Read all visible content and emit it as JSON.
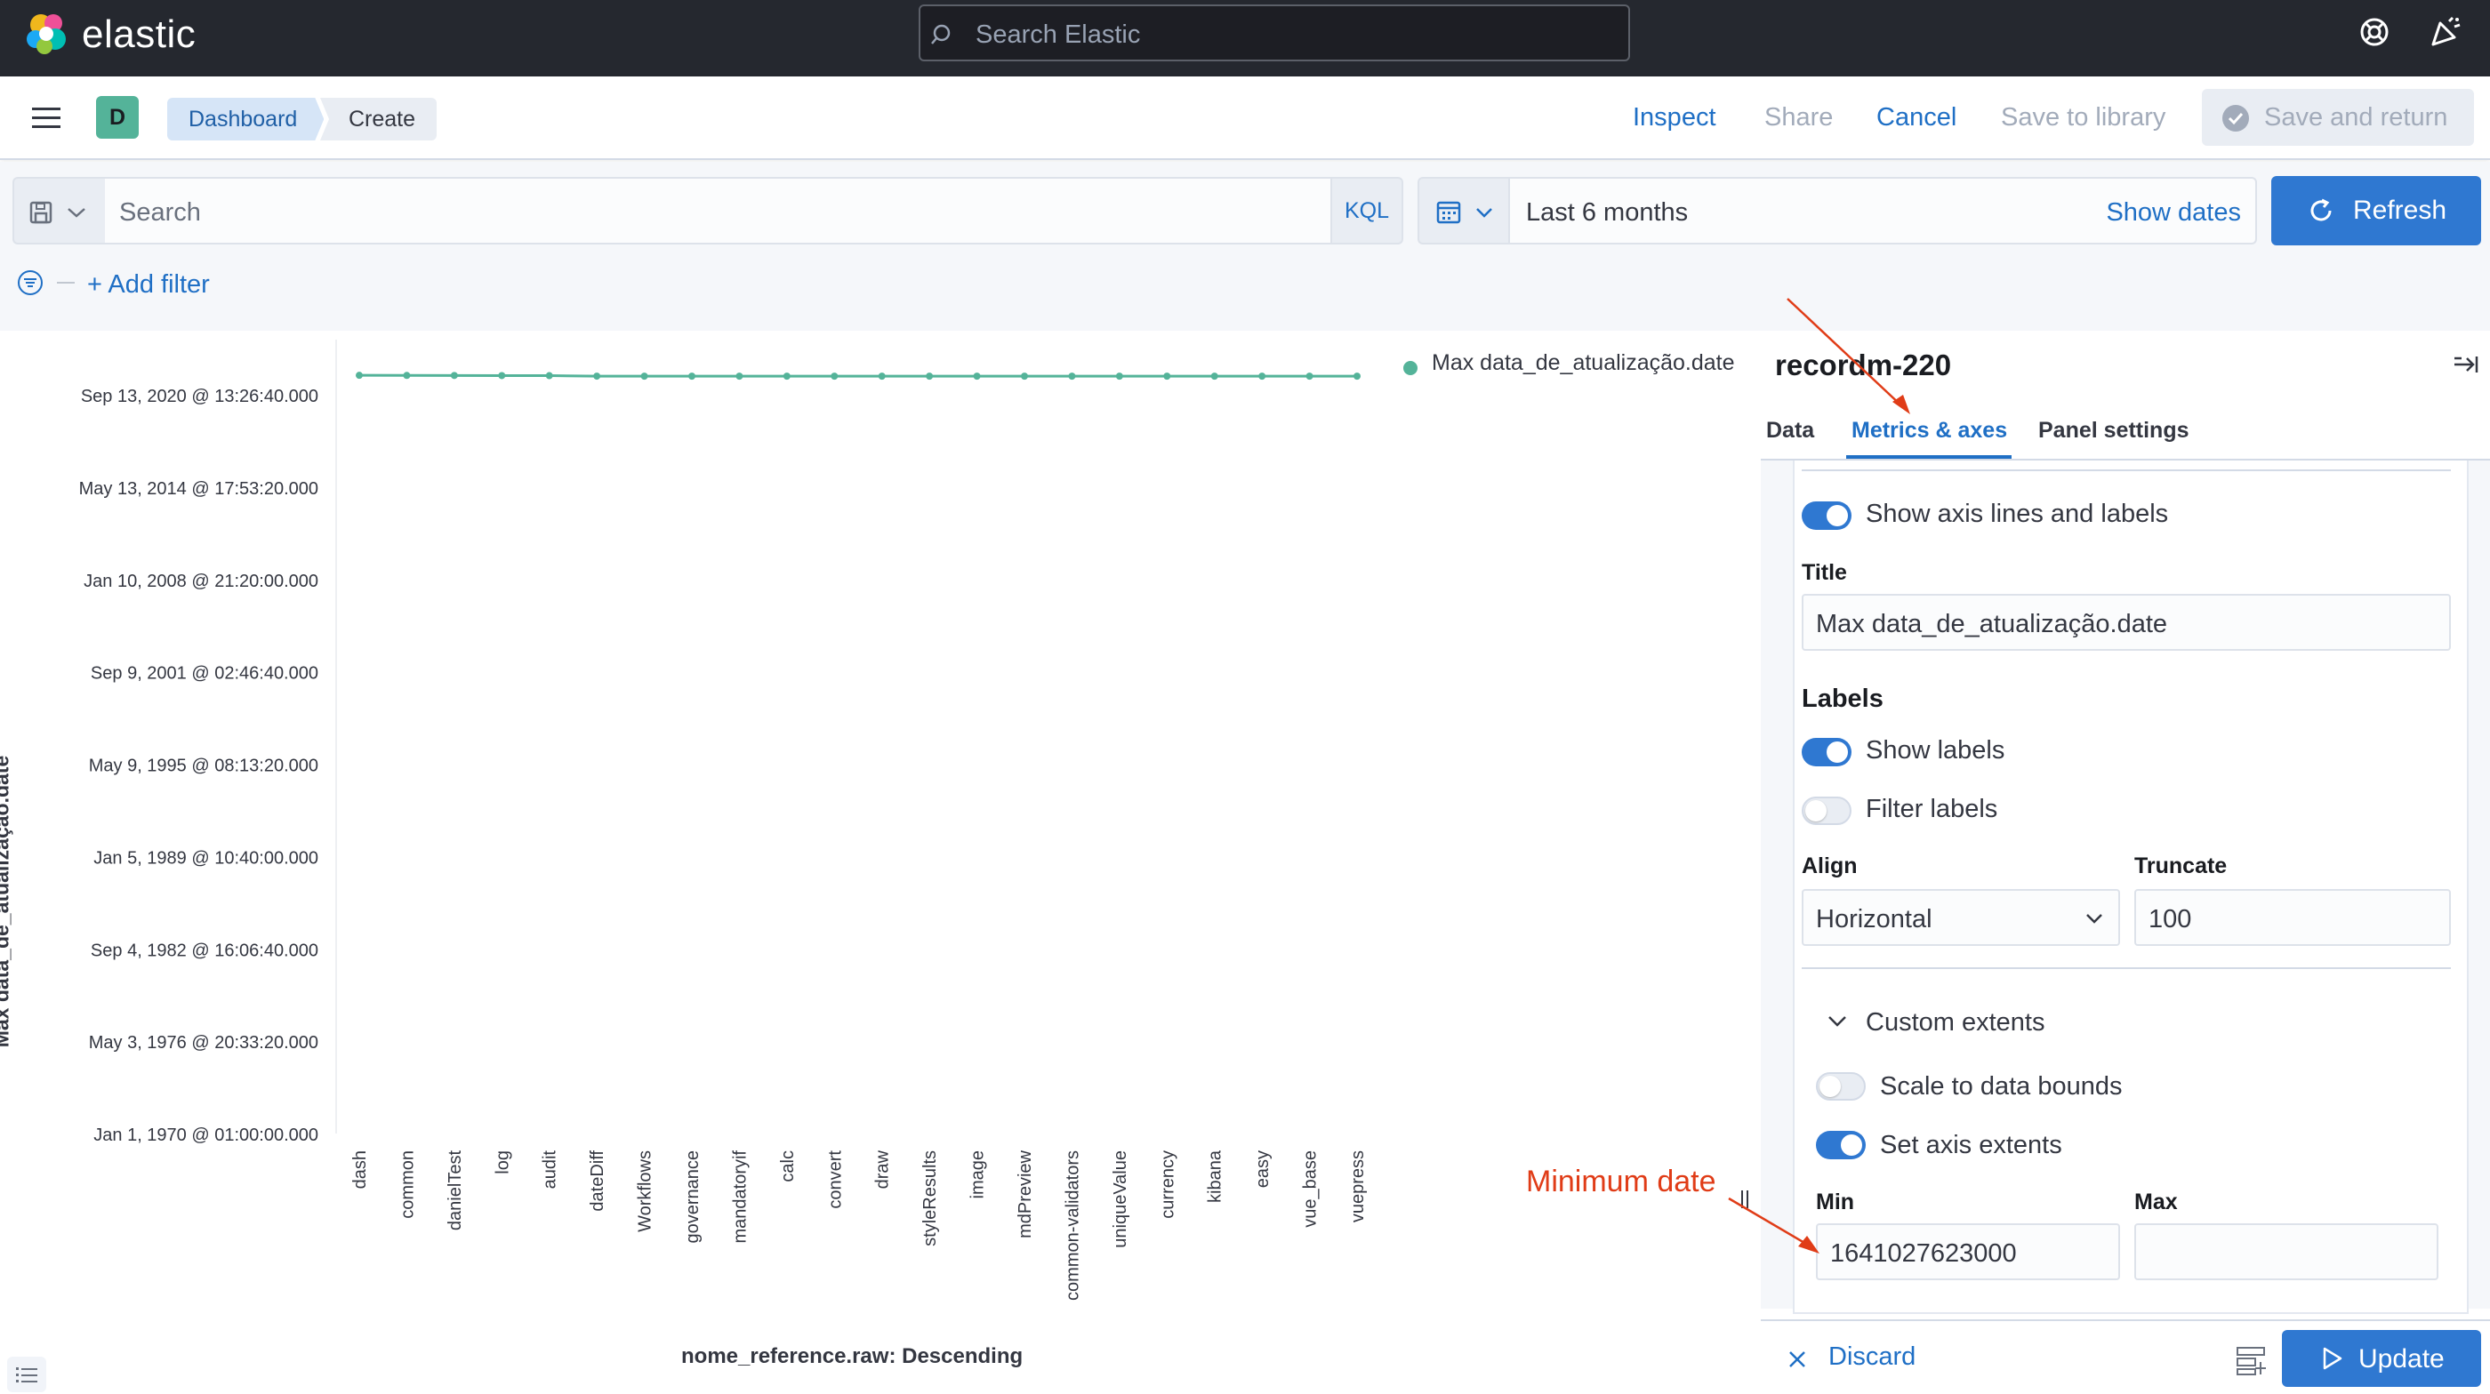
{
  "header": {
    "logo_text": "elastic",
    "search_placeholder": "Search Elastic"
  },
  "nav": {
    "space_initial": "D",
    "breadcrumbs": [
      "Dashboard",
      "Create"
    ],
    "inspect": "Inspect",
    "share": "Share",
    "cancel": "Cancel",
    "save_to_library": "Save to library",
    "save_and_return": "Save and return"
  },
  "query": {
    "search_placeholder": "Search",
    "language": "KQL",
    "date_range": "Last 6 months",
    "show_dates": "Show dates",
    "refresh": "Refresh",
    "add_filter": "+ Add filter"
  },
  "chart_data": {
    "type": "line",
    "title": "",
    "xlabel": "nome_reference.raw: Descending",
    "ylabel": "Max data_de_atualização.date",
    "categories": [
      "dash",
      "common",
      "danielTest",
      "log",
      "audit",
      "dateDiff",
      "Workflows",
      "governance",
      "mandatoryif",
      "calc",
      "convert",
      "draw",
      "styleResults",
      "image",
      "mdPreview",
      "common-validators",
      "uniqueValue",
      "currency",
      "kibana",
      "easy",
      "vue_base",
      "vuepress"
    ],
    "y_ticks": [
      "Jan 1, 1970 @ 01:00:00.000",
      "May 3, 1976 @ 20:33:20.000",
      "Sep 4, 1982 @ 16:06:40.000",
      "Jan 5, 1989 @ 10:40:00.000",
      "May 9, 1995 @ 08:13:20.000",
      "Sep 9, 2001 @ 02:46:40.000",
      "Jan 10, 2008 @ 21:20:00.000",
      "May 13, 2014 @ 17:53:20.000",
      "Sep 13, 2020 @ 13:26:40.000"
    ],
    "ylim_epoch_ms": [
      0,
      1750000000000
    ],
    "series": [
      {
        "name": "Max data_de_atualização.date",
        "color": "#54b399",
        "values": [
          1642000000000,
          1641800000000,
          1641700000000,
          1641500000000,
          1641300000000,
          1640300000000,
          1640200000000,
          1640200000000,
          1640200000000,
          1640200000000,
          1640200000000,
          1640200000000,
          1640200000000,
          1640200000000,
          1640200000000,
          1640200000000,
          1640200000000,
          1640200000000,
          1640200000000,
          1640200000000,
          1640200000000,
          1640200000000
        ]
      }
    ],
    "legend_position": "top-right",
    "grid": false
  },
  "panel": {
    "title": "recordm-220",
    "tabs": [
      "Data",
      "Metrics & axes",
      "Panel settings"
    ],
    "active_tab": "Metrics & axes",
    "show_axis_lines_label": "Show axis lines and labels",
    "show_axis_lines": true,
    "title_label": "Title",
    "title_value": "Max data_de_atualização.date",
    "labels_heading": "Labels",
    "show_labels_label": "Show labels",
    "show_labels": true,
    "filter_labels_label": "Filter labels",
    "filter_labels": false,
    "align_label": "Align",
    "align_value": "Horizontal",
    "truncate_label": "Truncate",
    "truncate_value": "100",
    "custom_extents_label": "Custom extents",
    "scale_to_bounds_label": "Scale to data bounds",
    "scale_to_bounds": false,
    "set_axis_extents_label": "Set axis extents",
    "set_axis_extents": true,
    "min_label": "Min",
    "min_value": "1641027623000",
    "max_label": "Max",
    "max_value": "",
    "discard": "Discard",
    "update": "Update"
  },
  "annotations": {
    "minimum_date": "Minimum date",
    "color": "#e03c17"
  },
  "colors": {
    "accent": "#2f78d1",
    "series": "#54b399",
    "header_bg": "#25282f"
  }
}
